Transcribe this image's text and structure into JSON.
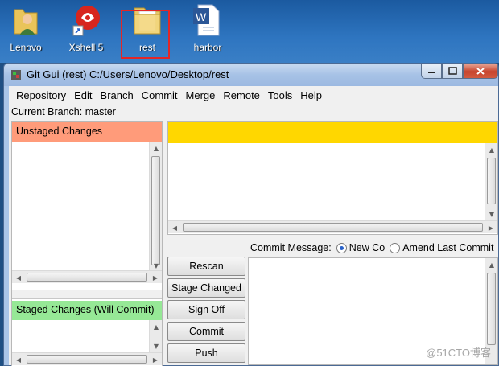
{
  "desktop": {
    "icons": [
      {
        "label": "Lenovo",
        "icon": "user-folder-icon"
      },
      {
        "label": "Xshell 5",
        "icon": "xshell-icon"
      },
      {
        "label": "rest",
        "icon": "folder-icon"
      },
      {
        "label": "harbor",
        "icon": "word-document-icon"
      }
    ]
  },
  "window": {
    "title": "Git Gui (rest) C:/Users/Lenovo/Desktop/rest"
  },
  "menubar": {
    "items": [
      "Repository",
      "Edit",
      "Branch",
      "Commit",
      "Merge",
      "Remote",
      "Tools",
      "Help"
    ]
  },
  "branch": {
    "label": "Current Branch: master"
  },
  "panes": {
    "unstaged_label": "Unstaged Changes",
    "staged_label": "Staged Changes (Will Commit)"
  },
  "commit": {
    "message_label": "Commit Message:",
    "new_commit_label": "New Co",
    "amend_label": "Amend Last Commit",
    "selected_mode": "new"
  },
  "buttons": {
    "rescan": "Rescan",
    "stage_changed": "Stage Changed",
    "sign_off": "Sign Off",
    "commit": "Commit",
    "push": "Push"
  },
  "watermark": "@51CTO博客",
  "colors": {
    "unstaged_header": "#ff9b7a",
    "staged_header": "#96e896",
    "diff_header": "#ffd700",
    "selection_outline": "#e32626"
  }
}
